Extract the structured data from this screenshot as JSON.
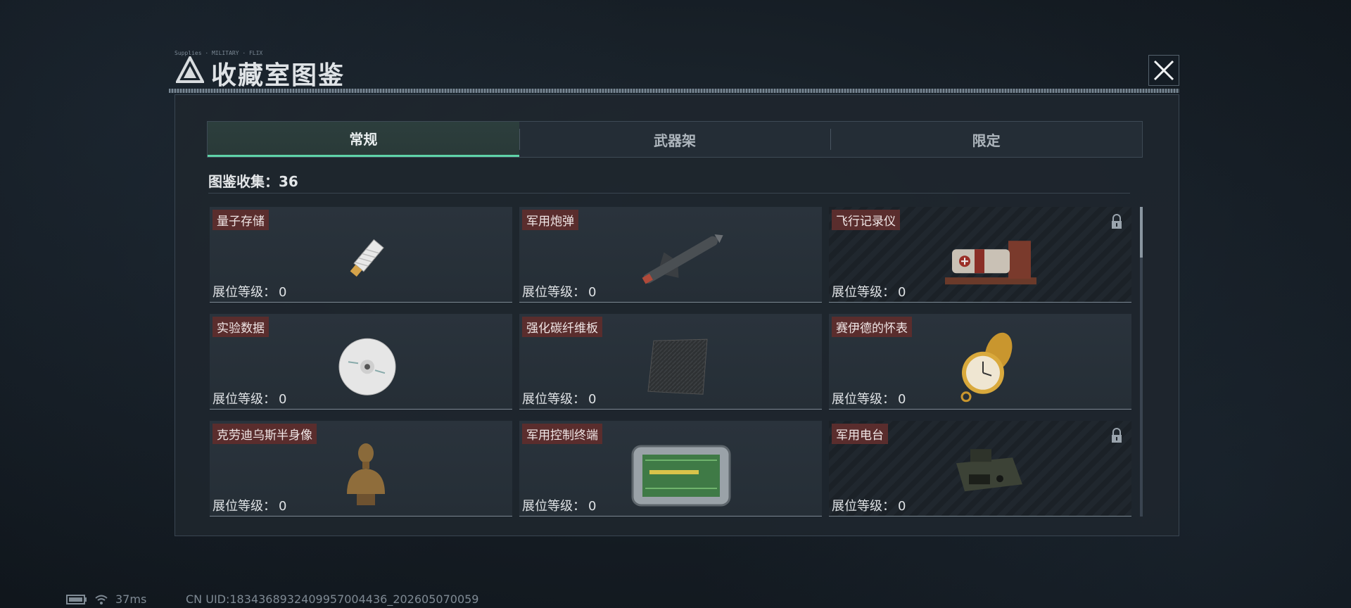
{
  "window": {
    "title": "收藏室图鉴",
    "caption": "Supplies · MILITARY · FLIX"
  },
  "tabs": [
    {
      "label": "常规",
      "active": true
    },
    {
      "label": "武器架",
      "active": false
    },
    {
      "label": "限定",
      "active": false
    }
  ],
  "collection": {
    "label": "图鉴收集：",
    "count": "36"
  },
  "level_label": "展位等级：",
  "items": [
    {
      "name": "量子存储",
      "level": "0",
      "locked": false,
      "icon": "usb-drive-icon"
    },
    {
      "name": "军用炮弹",
      "level": "0",
      "locked": false,
      "icon": "missile-icon"
    },
    {
      "name": "飞行记录仪",
      "level": "0",
      "locked": true,
      "icon": "flight-recorder-icon"
    },
    {
      "name": "实验数据",
      "level": "0",
      "locked": false,
      "icon": "disc-icon"
    },
    {
      "name": "强化碳纤维板",
      "level": "0",
      "locked": false,
      "icon": "carbon-plate-icon"
    },
    {
      "name": "赛伊德的怀表",
      "level": "0",
      "locked": false,
      "icon": "pocket-watch-icon"
    },
    {
      "name": "克劳迪乌斯半身像",
      "level": "0",
      "locked": false,
      "icon": "bust-icon"
    },
    {
      "name": "军用控制终端",
      "level": "0",
      "locked": false,
      "icon": "control-terminal-icon"
    },
    {
      "name": "军用电台",
      "level": "0",
      "locked": true,
      "icon": "radio-icon"
    }
  ],
  "status": {
    "ping": "37ms",
    "uid": "CN UID:1834368932409957004436_202605070059"
  },
  "colors": {
    "accent": "#5fd3a8",
    "name_badge": "#5a2d2d",
    "panel": "#1e262e"
  }
}
